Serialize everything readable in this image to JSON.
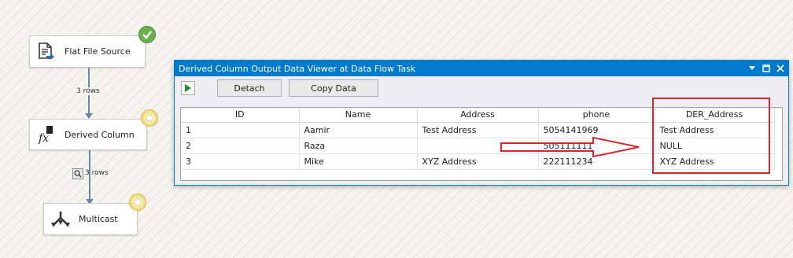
{
  "designer": {
    "nodes": [
      {
        "label": "Flat File Source",
        "status": "success"
      },
      {
        "label": "Derived Column",
        "status": "running"
      },
      {
        "label": "Multicast",
        "status": "running"
      }
    ],
    "paths": [
      {
        "label": "3 rows"
      },
      {
        "label": "3 rows"
      }
    ]
  },
  "viewer": {
    "title": "Derived Column Output Data Viewer at Data Flow Task",
    "toolbar": {
      "detach_label": "Detach",
      "copy_label": "Copy Data"
    },
    "columns": [
      "ID",
      "Name",
      "Address",
      "phone",
      "DER_Address"
    ],
    "rows": [
      [
        "1",
        "Aamir",
        "Test Address",
        "5054141969",
        "Test Address"
      ],
      [
        "2",
        "Raza",
        "",
        "505111111",
        "NULL"
      ],
      [
        "3",
        "Mike",
        "XYZ Address",
        "222111234",
        "XYZ Address"
      ]
    ]
  },
  "colors": {
    "titlebar": "#007acc",
    "annotation": "#d9262e",
    "connector": "#6a86ad",
    "success_badge": "#6ab04c",
    "running_badge": "#e8c85a"
  }
}
